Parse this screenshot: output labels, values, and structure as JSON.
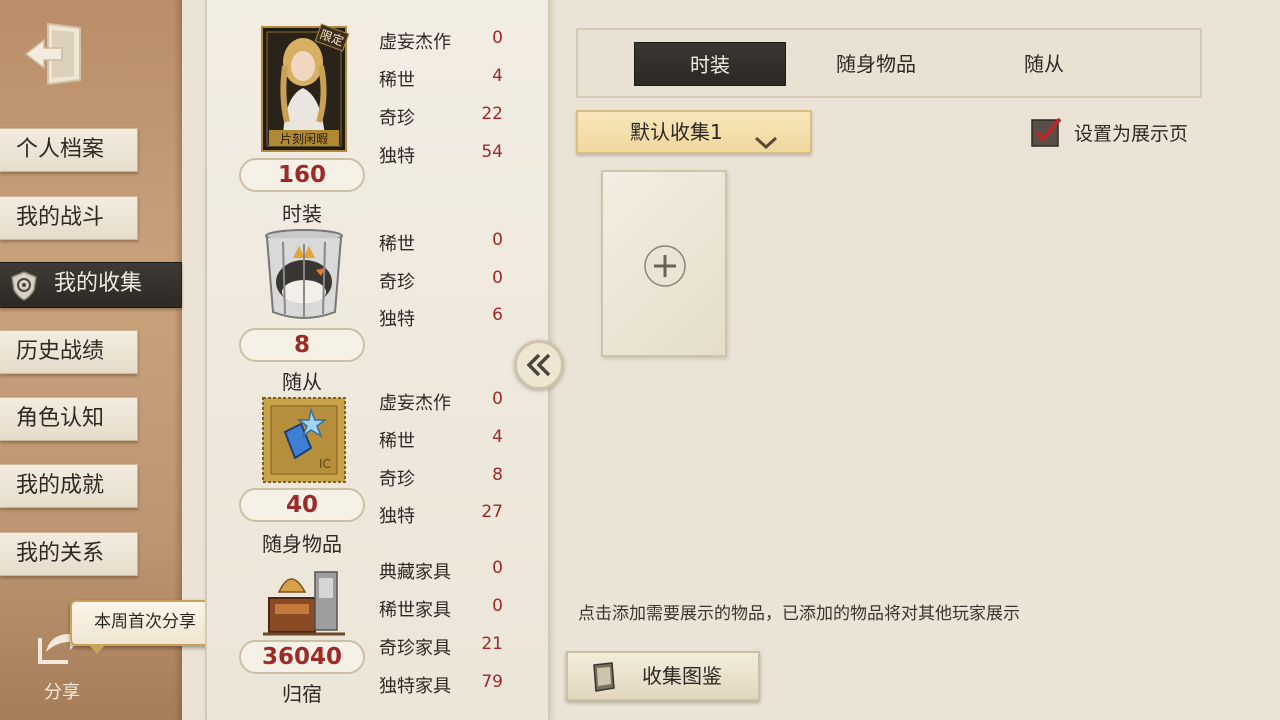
{
  "sidebar": {
    "items": [
      {
        "label": "个人档案",
        "name": "sidebar-item-profile"
      },
      {
        "label": "我的战斗",
        "name": "sidebar-item-battle"
      },
      {
        "label": "我的收集",
        "name": "sidebar-item-collection",
        "active": true
      },
      {
        "label": "历史战绩",
        "name": "sidebar-item-history"
      },
      {
        "label": "角色认知",
        "name": "sidebar-item-character"
      },
      {
        "label": "我的成就",
        "name": "sidebar-item-achievements"
      },
      {
        "label": "我的关系",
        "name": "sidebar-item-relations"
      }
    ],
    "share_bubble": "本周首次分享",
    "share_label": "分享"
  },
  "stats": {
    "costume": {
      "badge": "限定",
      "card_caption": "片刻闲暇",
      "count": "160",
      "label": "时装",
      "rows": [
        {
          "name": "虚妄杰作",
          "value": "0"
        },
        {
          "name": "稀世",
          "value": "4"
        },
        {
          "name": "奇珍",
          "value": "22"
        },
        {
          "name": "独特",
          "value": "54"
        }
      ]
    },
    "follower": {
      "count": "8",
      "label": "随从",
      "rows": [
        {
          "name": "稀世",
          "value": "0"
        },
        {
          "name": "奇珍",
          "value": "0"
        },
        {
          "name": "独特",
          "value": "6"
        }
      ]
    },
    "accessory": {
      "count": "40",
      "label": "随身物品",
      "rows": [
        {
          "name": "虚妄杰作",
          "value": "0"
        },
        {
          "name": "稀世",
          "value": "4"
        },
        {
          "name": "奇珍",
          "value": "8"
        },
        {
          "name": "独特",
          "value": "27"
        }
      ]
    },
    "home": {
      "count": "36040",
      "label": "归宿",
      "rows": [
        {
          "name": "典藏家具",
          "value": "0"
        },
        {
          "name": "稀世家具",
          "value": "0"
        },
        {
          "name": "奇珍家具",
          "value": "21"
        },
        {
          "name": "独特家具",
          "value": "79"
        }
      ]
    }
  },
  "tabs": [
    {
      "label": "时装",
      "active": true
    },
    {
      "label": "随身物品",
      "active": false
    },
    {
      "label": "随从",
      "active": false
    }
  ],
  "dropdown": {
    "value": "默认收集1"
  },
  "display_checkbox": {
    "label": "设置为展示页",
    "checked": true
  },
  "hint": "点击添加需要展示的物品，已添加的物品将对其他玩家展示",
  "catalog_button": "收集图鉴",
  "colors": {
    "accent_red": "#9b2a28",
    "dark_tab": "#2c2925",
    "gold": "#d9bf84"
  }
}
